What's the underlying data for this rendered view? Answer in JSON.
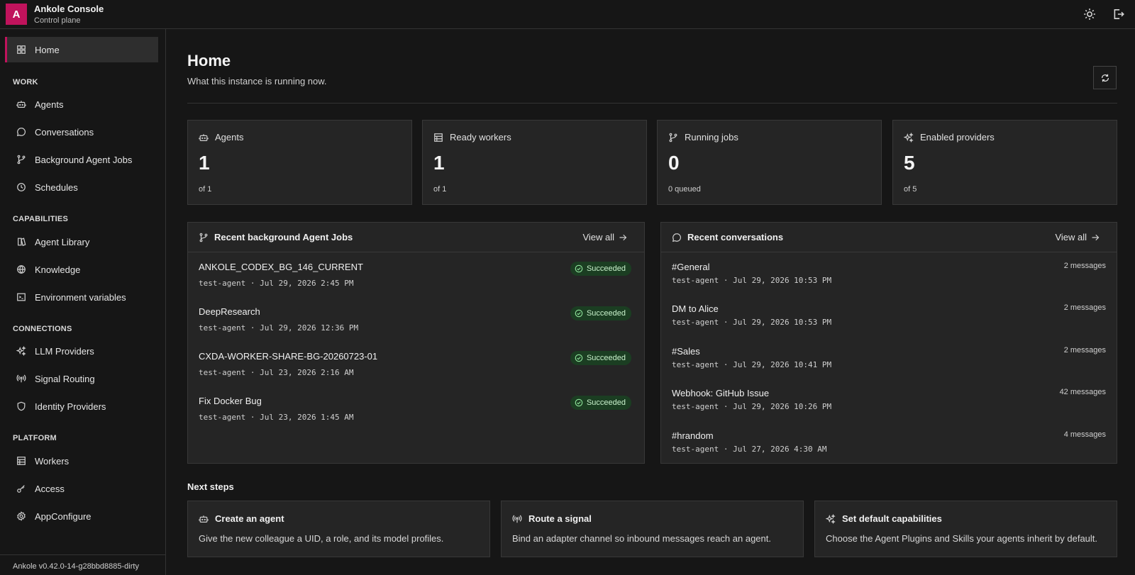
{
  "app": {
    "logo_letter": "A",
    "title": "Ankole Console",
    "subtitle": "Control plane"
  },
  "topbar": {
    "theme_icon": "sun-icon",
    "logout_icon": "logout-icon"
  },
  "sidebar": {
    "home": {
      "label": "Home",
      "icon": "grid-icon"
    },
    "sections": {
      "work": "WORK",
      "capabilities": "CAPABILITIES",
      "connections": "CONNECTIONS",
      "platform": "PLATFORM"
    },
    "work_items": [
      {
        "label": "Agents",
        "icon": "bot-icon"
      },
      {
        "label": "Conversations",
        "icon": "chat-bubble-icon"
      },
      {
        "label": "Background Agent Jobs",
        "icon": "git-branch-icon"
      },
      {
        "label": "Schedules",
        "icon": "clock-icon"
      }
    ],
    "capability_items": [
      {
        "label": "Agent Library",
        "icon": "library-icon"
      },
      {
        "label": "Knowledge",
        "icon": "globe-icon"
      },
      {
        "label": "Environment variables",
        "icon": "terminal-icon"
      }
    ],
    "connection_items": [
      {
        "label": "LLM Providers",
        "icon": "sparkles-icon"
      },
      {
        "label": "Signal Routing",
        "icon": "radio-icon"
      },
      {
        "label": "Identity Providers",
        "icon": "shield-icon"
      }
    ],
    "platform_items": [
      {
        "label": "Workers",
        "icon": "server-icon"
      },
      {
        "label": "Access",
        "icon": "key-icon"
      },
      {
        "label": "AppConfigure",
        "icon": "gear-icon"
      }
    ],
    "version": "Ankole v0.42.0-14-g28bbd8885-dirty"
  },
  "main": {
    "title": "Home",
    "subtitle": "What this instance is running now.",
    "refresh_icon": "refresh-icon",
    "stats": [
      {
        "label": "Agents",
        "value": "1",
        "sub": "of 1",
        "icon": "bot-icon"
      },
      {
        "label": "Ready workers",
        "value": "1",
        "sub": "of 1",
        "icon": "server-icon"
      },
      {
        "label": "Running jobs",
        "value": "0",
        "sub": "0 queued",
        "icon": "git-branch-icon"
      },
      {
        "label": "Enabled providers",
        "value": "5",
        "sub": "of 5",
        "icon": "sparkles-icon"
      }
    ],
    "jobs_panel": {
      "title": "Recent background Agent Jobs",
      "view_all": "View all",
      "rows": [
        {
          "name": "ANKOLE_CODEX_BG_146_CURRENT",
          "meta": "test-agent · Jul 29, 2026 2:45 PM",
          "status": "Succeeded"
        },
        {
          "name": "DeepResearch",
          "meta": "test-agent · Jul 29, 2026 12:36 PM",
          "status": "Succeeded"
        },
        {
          "name": "CXDA-WORKER-SHARE-BG-20260723-01",
          "meta": "test-agent · Jul 23, 2026 2:16 AM",
          "status": "Succeeded"
        },
        {
          "name": "Fix Docker Bug",
          "meta": "test-agent · Jul 23, 2026 1:45 AM",
          "status": "Succeeded"
        }
      ]
    },
    "conversations_panel": {
      "title": "Recent conversations",
      "view_all": "View all",
      "rows": [
        {
          "name": "#General",
          "meta": "test-agent · Jul 29, 2026 10:53 PM",
          "count": "2 messages"
        },
        {
          "name": "DM to Alice",
          "meta": "test-agent · Jul 29, 2026 10:53 PM",
          "count": "2 messages"
        },
        {
          "name": "#Sales",
          "meta": "test-agent · Jul 29, 2026 10:41 PM",
          "count": "2 messages"
        },
        {
          "name": "Webhook: GitHub Issue",
          "meta": "test-agent · Jul 29, 2026 10:26 PM",
          "count": "42 messages"
        },
        {
          "name": "#hrandom",
          "meta": "test-agent · Jul 27, 2026 4:30 AM",
          "count": "4 messages"
        }
      ]
    },
    "next_steps": {
      "title": "Next steps",
      "items": [
        {
          "title": "Create an agent",
          "desc": "Give the new colleague a UID, a role, and its model profiles.",
          "icon": "bot-icon"
        },
        {
          "title": "Route a signal",
          "desc": "Bind an adapter channel so inbound messages reach an agent.",
          "icon": "radio-icon"
        },
        {
          "title": "Set default capabilities",
          "desc": "Choose the Agent Plugins and Skills your agents inherit by default.",
          "icon": "sparkles-icon"
        }
      ]
    }
  }
}
